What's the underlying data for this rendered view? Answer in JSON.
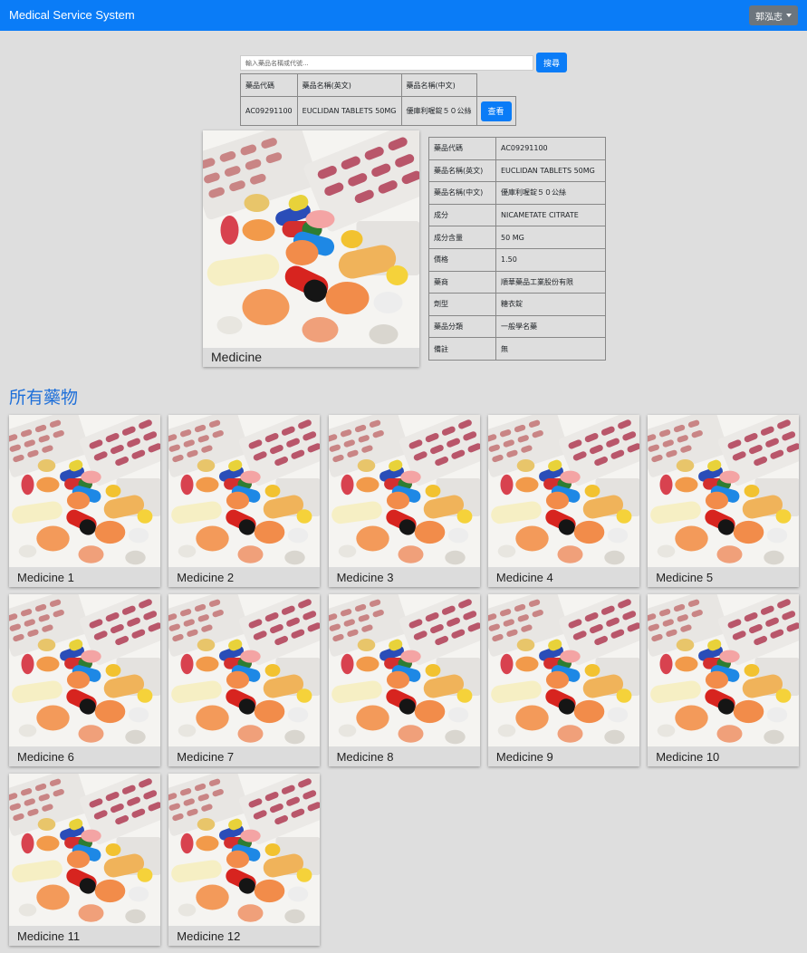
{
  "navbar": {
    "brand": "Medical Service System",
    "user_name": "郭泓志"
  },
  "search": {
    "placeholder": "輸入藥品名稱或代號...",
    "button": "搜尋"
  },
  "results": {
    "headers": [
      "藥品代碼",
      "藥品名稱(英文)",
      "藥品名稱(中文)"
    ],
    "rows": [
      {
        "code": "AC09291100",
        "name_en": "EUCLIDAN TABLETS 50MG",
        "name_zh": "優庫利喔錠５０公絲",
        "action": "查看"
      }
    ]
  },
  "featured": {
    "name": "Medicine"
  },
  "detail": [
    {
      "label": "藥品代碼",
      "value": "AC09291100"
    },
    {
      "label": "藥品名稱(英文)",
      "value": "EUCLIDAN TABLETS 50MG"
    },
    {
      "label": "藥品名稱(中文)",
      "value": "優庫利喔錠５０公絲"
    },
    {
      "label": "成分",
      "value": "NICAMETATE CITRATE"
    },
    {
      "label": "成分含量",
      "value": "50 MG"
    },
    {
      "label": "價格",
      "value": "1.50"
    },
    {
      "label": "藥商",
      "value": "順華藥品工業股份有限"
    },
    {
      "label": "劑型",
      "value": "糖衣錠"
    },
    {
      "label": "藥品分類",
      "value": "一般學名藥"
    },
    {
      "label": "備註",
      "value": "無"
    }
  ],
  "section_title": "所有藥物",
  "medicines": [
    "Medicine 1",
    "Medicine 2",
    "Medicine 3",
    "Medicine 4",
    "Medicine 5",
    "Medicine 6",
    "Medicine 7",
    "Medicine 8",
    "Medicine 9",
    "Medicine 10",
    "Medicine 11",
    "Medicine 12"
  ]
}
